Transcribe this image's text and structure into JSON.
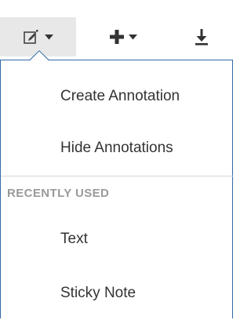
{
  "toolbar": {
    "buttons": [
      {
        "icon": "edit-annotation-icon",
        "has_dropdown": true,
        "active": true
      },
      {
        "icon": "plus-icon",
        "has_dropdown": true,
        "active": false
      },
      {
        "icon": "download-icon",
        "has_dropdown": false,
        "active": false
      }
    ]
  },
  "menu": {
    "items": [
      {
        "label": "Create Annotation"
      },
      {
        "label": "Hide Annotations"
      }
    ],
    "section_label": "RECENTLY USED",
    "recent_items": [
      {
        "label": "Text"
      },
      {
        "label": "Sticky Note"
      }
    ]
  },
  "colors": {
    "menu_border": "#2f6aa8",
    "text": "#333333",
    "section_label": "#9a9a9a",
    "active_button_bg": "#e8e8e8"
  }
}
